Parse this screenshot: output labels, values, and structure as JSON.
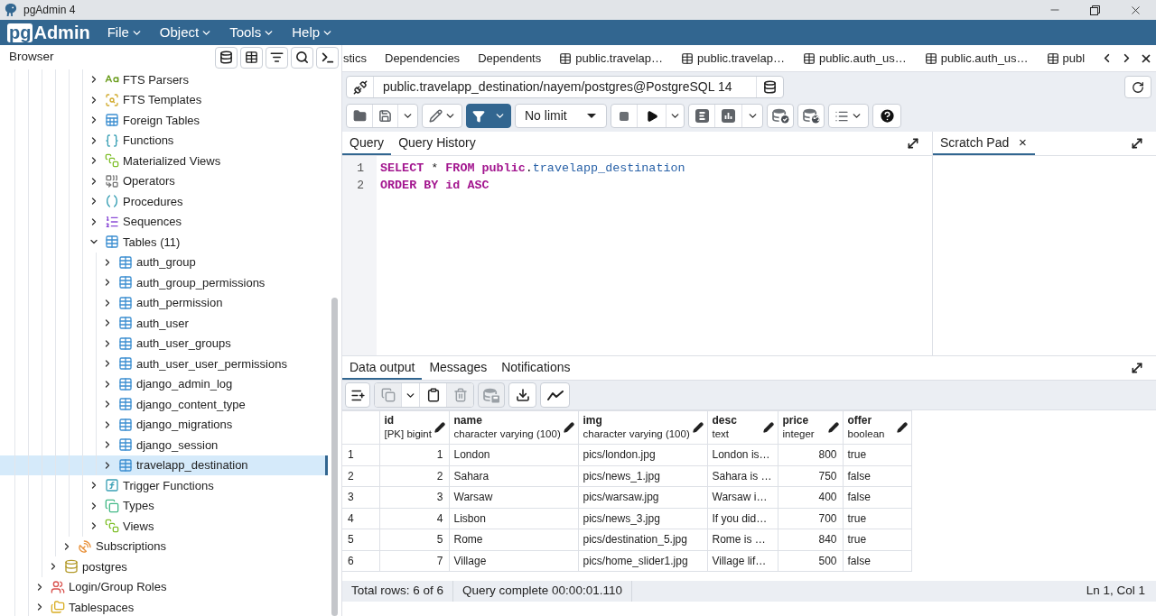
{
  "window": {
    "title": "pgAdmin 4"
  },
  "menubar": {
    "logo": {
      "mark": "pg",
      "name": "Admin"
    },
    "menus": [
      "File",
      "Object",
      "Tools",
      "Help"
    ]
  },
  "browser": {
    "title": "Browser",
    "tree": [
      {
        "children": [
          {
            "children": [
              {
                "children": [
                  {
                    "children": [
                      {
                        "children": [
                          {
                            "children": [
                              {
                                "label": "FTS Parsers",
                                "kind": "parser",
                                "expanded": false,
                                "selected": false
                              },
                              {
                                "label": "FTS Templates",
                                "kind": "template",
                                "expanded": false,
                                "selected": false
                              },
                              {
                                "label": "Foreign Tables",
                                "kind": "foreigntable",
                                "expanded": false,
                                "selected": false
                              },
                              {
                                "label": "Functions",
                                "kind": "function",
                                "expanded": false,
                                "selected": false
                              },
                              {
                                "label": "Materialized Views",
                                "kind": "matview",
                                "expanded": false,
                                "selected": false
                              },
                              {
                                "label": "Operators",
                                "kind": "operator",
                                "expanded": false,
                                "selected": false
                              },
                              {
                                "label": "Procedures",
                                "kind": "procedure",
                                "expanded": false,
                                "selected": false
                              },
                              {
                                "label": "Sequences",
                                "kind": "sequence",
                                "expanded": false,
                                "selected": false
                              },
                              {
                                "label": "Tables (11)",
                                "kind": "tables",
                                "expanded": true,
                                "selected": false,
                                "children": [
                                  {
                                    "label": "auth_group",
                                    "kind": "table",
                                    "expanded": false,
                                    "selected": false
                                  },
                                  {
                                    "label": "auth_group_permissions",
                                    "kind": "table",
                                    "expanded": false,
                                    "selected": false
                                  },
                                  {
                                    "label": "auth_permission",
                                    "kind": "table",
                                    "expanded": false,
                                    "selected": false
                                  },
                                  {
                                    "label": "auth_user",
                                    "kind": "table",
                                    "expanded": false,
                                    "selected": false
                                  },
                                  {
                                    "label": "auth_user_groups",
                                    "kind": "table",
                                    "expanded": false,
                                    "selected": false
                                  },
                                  {
                                    "label": "auth_user_user_permissions",
                                    "kind": "table",
                                    "expanded": false,
                                    "selected": false
                                  },
                                  {
                                    "label": "django_admin_log",
                                    "kind": "table",
                                    "expanded": false,
                                    "selected": false
                                  },
                                  {
                                    "label": "django_content_type",
                                    "kind": "table",
                                    "expanded": false,
                                    "selected": false
                                  },
                                  {
                                    "label": "django_migrations",
                                    "kind": "table",
                                    "expanded": false,
                                    "selected": false
                                  },
                                  {
                                    "label": "django_session",
                                    "kind": "table",
                                    "expanded": false,
                                    "selected": false
                                  },
                                  {
                                    "label": "travelapp_destination",
                                    "kind": "table",
                                    "expanded": false,
                                    "selected": true
                                  }
                                ]
                              },
                              {
                                "label": "Trigger Functions",
                                "kind": "trigger",
                                "expanded": false,
                                "selected": false
                              },
                              {
                                "label": "Types",
                                "kind": "type",
                                "expanded": false,
                                "selected": false
                              },
                              {
                                "label": "Views",
                                "kind": "view",
                                "expanded": false,
                                "selected": false
                              }
                            ]
                          }
                        ]
                      },
                      {
                        "label": "Subscriptions",
                        "kind": "subscription",
                        "expanded": false,
                        "selected": false
                      }
                    ]
                  },
                  {
                    "label": "postgres",
                    "kind": "database",
                    "expanded": false,
                    "selected": false
                  }
                ]
              },
              {
                "label": "Login/Group Roles",
                "kind": "roles",
                "expanded": false,
                "selected": false
              },
              {
                "label": "Tablespaces",
                "kind": "tablespace",
                "expanded": false,
                "selected": false
              }
            ]
          }
        ]
      }
    ]
  },
  "tabs": [
    {
      "label": "stics",
      "kind": "plain",
      "selected": false
    },
    {
      "label": "Dependencies",
      "kind": "plain",
      "selected": false
    },
    {
      "label": "Dependents",
      "kind": "plain",
      "selected": false
    },
    {
      "label": "public.travelap…",
      "kind": "table",
      "selected": false
    },
    {
      "label": "public.travelap…",
      "kind": "table",
      "selected": false
    },
    {
      "label": "public.auth_us…",
      "kind": "table",
      "selected": false
    },
    {
      "label": "public.auth_us…",
      "kind": "table",
      "selected": false
    },
    {
      "label": "publ",
      "kind": "table",
      "selected": false
    }
  ],
  "query_tool": {
    "connection": "public.travelapp_destination/nayem/postgres@PostgreSQL 14",
    "row_limit": "No limit",
    "editor_tabs": [
      {
        "label": "Query",
        "selected": true
      },
      {
        "label": "Query History",
        "selected": false
      }
    ],
    "scratch_pad": {
      "label": "Scratch Pad",
      "selected": true
    },
    "lines": [
      {
        "number": "1",
        "tokens": [
          {
            "text": "SELECT",
            "kind": "keyword"
          },
          {
            "text": " * ",
            "kind": "plain"
          },
          {
            "text": "FROM public",
            "kind": "keyword"
          },
          {
            "text": ".",
            "kind": "plain"
          },
          {
            "text": "travelapp_destination",
            "kind": "name"
          }
        ]
      },
      {
        "number": "2",
        "tokens": [
          {
            "text": "ORDER BY id ASC",
            "kind": "keyword"
          }
        ]
      }
    ]
  },
  "output": {
    "tabs": [
      {
        "label": "Data output",
        "selected": true
      },
      {
        "label": "Messages",
        "selected": false
      },
      {
        "label": "Notifications",
        "selected": false
      }
    ],
    "toolbar": [
      {
        "kind": "addrow",
        "disabled": false
      },
      {
        "kind": "copy",
        "disabled": true
      },
      {
        "kind": "copymenu",
        "disabled": false
      },
      {
        "kind": "paste",
        "disabled": false
      },
      {
        "kind": "delete",
        "disabled": true
      },
      {
        "kind": "savedata",
        "disabled": true
      },
      {
        "kind": "download",
        "disabled": false
      },
      {
        "kind": "graph",
        "disabled": false
      }
    ],
    "columns": [
      {
        "name": "id",
        "type": "[PK] bigint",
        "kind": "number"
      },
      {
        "name": "name",
        "type": "character varying (100)",
        "kind": "text"
      },
      {
        "name": "img",
        "type": "character varying (100)",
        "kind": "text"
      },
      {
        "name": "desc",
        "type": "text",
        "kind": "text"
      },
      {
        "name": "price",
        "type": "integer",
        "kind": "number"
      },
      {
        "name": "offer",
        "type": "boolean",
        "kind": "text"
      }
    ],
    "rows": [
      {
        "number": "1",
        "cells": [
          "1",
          "London",
          "pics/london.jpg",
          "London is…",
          "800",
          "true"
        ]
      },
      {
        "number": "2",
        "cells": [
          "2",
          "Sahara",
          "pics/news_1.jpg",
          "Sahara is …",
          "750",
          "false"
        ]
      },
      {
        "number": "3",
        "cells": [
          "3",
          "Warsaw",
          "pics/warsaw.jpg",
          "Warsaw i…",
          "400",
          "false"
        ]
      },
      {
        "number": "4",
        "cells": [
          "4",
          "Lisbon",
          "pics/news_3.jpg",
          "If you did…",
          "700",
          "true"
        ]
      },
      {
        "number": "5",
        "cells": [
          "5",
          "Rome",
          "pics/destination_5.jpg",
          "Rome is …",
          "840",
          "true"
        ]
      },
      {
        "number": "6",
        "cells": [
          "7",
          "Village",
          "pics/home_slider1.jpg",
          "Village lif…",
          "500",
          "false"
        ]
      }
    ],
    "status": {
      "rows": "Total rows: 6 of 6",
      "query": "Query complete 00:00:01.110",
      "cursor": "Ln 1, Col 1"
    }
  }
}
